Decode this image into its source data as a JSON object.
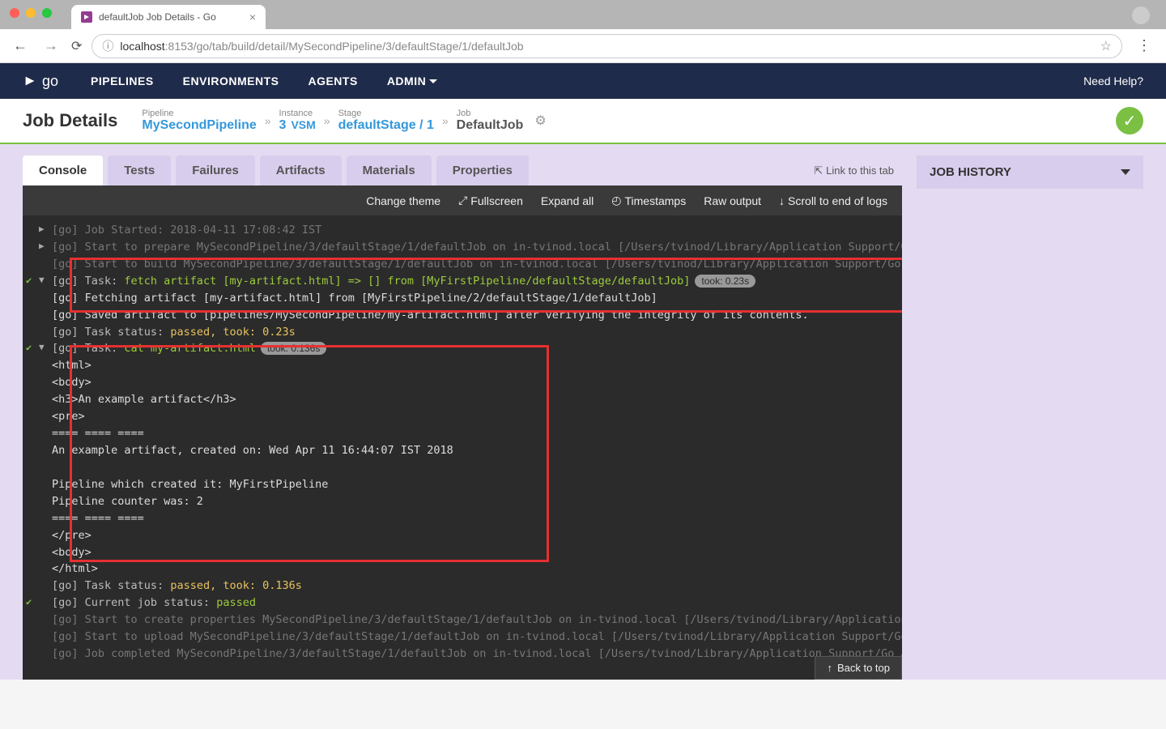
{
  "browser": {
    "tab_title": "defaultJob Job Details - Go",
    "url_host": "localhost",
    "url_path": ":8153/go/tab/build/detail/MySecondPipeline/3/defaultStage/1/defaultJob"
  },
  "nav": {
    "pipelines": "PIPELINES",
    "environments": "ENVIRONMENTS",
    "agents": "AGENTS",
    "admin": "ADMIN",
    "help": "Need Help?",
    "logo_text": "go"
  },
  "breadcrumb": {
    "title": "Job Details",
    "pipeline_label": "Pipeline",
    "pipeline": "MySecondPipeline",
    "instance_label": "Instance",
    "instance": "3",
    "vsm": "VSM",
    "stage_label": "Stage",
    "stage": "defaultStage / 1",
    "job_label": "Job",
    "job": "DefaultJob"
  },
  "tabs": {
    "console": "Console",
    "tests": "Tests",
    "failures": "Failures",
    "artifacts": "Artifacts",
    "materials": "Materials",
    "properties": "Properties",
    "link_to_tab": "Link to this tab"
  },
  "job_history": "JOB HISTORY",
  "console_tools": {
    "change_theme": "Change theme",
    "fullscreen": "Fullscreen",
    "expand_all": "Expand all",
    "timestamps": "Timestamps",
    "raw_output": "Raw output",
    "scroll_end": "Scroll to end of logs"
  },
  "console": {
    "l1": "[go] Job Started: 2018-04-11 17:08:42 IST",
    "l2": "[go] Start to prepare MySecondPipeline/3/defaultStage/1/defaultJob on in-tvinod.local [/Users/tvinod/Library/Application Support/Go Agent]",
    "l3": "[go] Start to build MySecondPipeline/3/defaultStage/1/defaultJob on in-tvinod.local [/Users/tvinod/Library/Application Support/Go Agent]",
    "l4_pre": "[go] Task: ",
    "l4_cmd": "fetch artifact [my-artifact.html] => [] from [MyFirstPipeline/defaultStage/defaultJob]",
    "l4_dur": "took: 0.23s",
    "l5": "[go] Fetching artifact [my-artifact.html] from [MyFirstPipeline/2/defaultStage/1/defaultJob]",
    "l6": "[go] Saved artifact to [pipelines/MySecondPipeline/my-artifact.html] after verifying the integrity of its contents.",
    "l7_pre": "[go] Task status: ",
    "l7_stat": "passed, took: 0.23s",
    "l8_pre": "[go] Task: ",
    "l8_cmd": "cat my-artifact.html",
    "l8_dur": "took: 0.136s",
    "l9": "<html>",
    "l10": "<body>",
    "l11": "<h3>An example artifact</h3>",
    "l12": "<pre>",
    "l13": "==== ==== ====",
    "l14": "An example artifact, created on: Wed Apr 11 16:44:07 IST 2018",
    "l15": "",
    "l16": "Pipeline which created it: MyFirstPipeline",
    "l17": "Pipeline counter was: 2",
    "l18": "==== ==== ====",
    "l19": "</pre>",
    "l20": "<body>",
    "l21": "</html>",
    "l22_pre": "[go] Task status: ",
    "l22_stat": "passed, took: 0.136s",
    "l23_pre": "[go] Current job status: ",
    "l23_stat": "passed",
    "l24": "[go] Start to create properties MySecondPipeline/3/defaultStage/1/defaultJob on in-tvinod.local [/Users/tvinod/Library/Application Support/Go Agent]",
    "l25": "[go] Start to upload MySecondPipeline/3/defaultStage/1/defaultJob on in-tvinod.local [/Users/tvinod/Library/Application Support/Go Agent]",
    "l26": "[go] Job completed MySecondPipeline/3/defaultStage/1/defaultJob on in-tvinod.local [/Users/tvinod/Library/Application Support/Go Agent]"
  },
  "back_to_top": "Back to top"
}
